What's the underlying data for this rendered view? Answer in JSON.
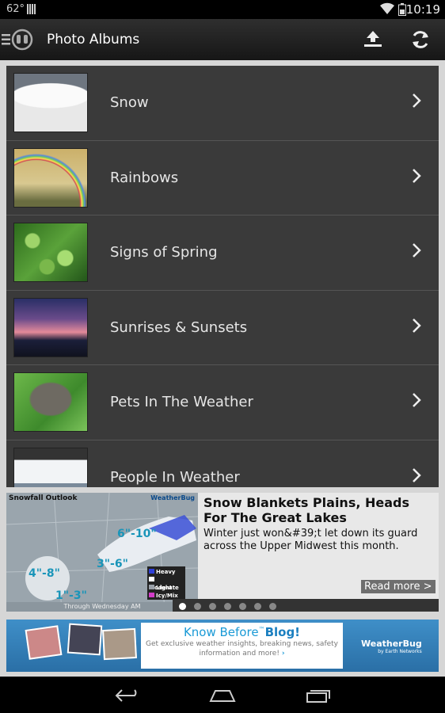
{
  "status_bar": {
    "temperature": "62°",
    "time": "10:19",
    "icons": [
      "notification-icon",
      "wifi-icon",
      "battery-icon"
    ]
  },
  "action_bar": {
    "title": "Photo Albums",
    "icons": [
      "menu-icon",
      "weatherbug-logo-icon",
      "upload-icon",
      "refresh-icon"
    ]
  },
  "albums": [
    {
      "label": "Snow"
    },
    {
      "label": "Rainbows"
    },
    {
      "label": "Signs of Spring"
    },
    {
      "label": "Sunrises & Sunsets"
    },
    {
      "label": "Pets In The Weather"
    },
    {
      "label": "People In Weather"
    }
  ],
  "carousel": {
    "map": {
      "title": "Snowfall Outlook",
      "brand": "WeatherBug",
      "footer": "Through Wednesday AM",
      "amounts": [
        "6\"-10\"",
        "3\"-6\"",
        "4\"-8\"",
        "1\"-3\""
      ],
      "legend": [
        {
          "label": "Heavy",
          "color": "#2f3fd8"
        },
        {
          "label": "Moderate",
          "color": "#ffffff"
        },
        {
          "label": "Light",
          "color": "#9aa0a8"
        },
        {
          "label": "Icy/Mix",
          "color": "#d23cc8"
        }
      ]
    },
    "headline": "Snow Blankets Plains, Heads For The Great Lakes",
    "summary": "Winter just won&#39;t let down its guard across the Upper Midwest this month.",
    "read_more": "Read more >",
    "page_count": 7,
    "active_page": 1
  },
  "ad": {
    "title_prefix": "Know Before",
    "title_tm": "™",
    "title_blog": "Blog!",
    "body": "Get exclusive weather insights, breaking news, safety information and more!",
    "arrow": "›",
    "brand": "WeatherBug",
    "brand_sub": "by Earth Networks"
  },
  "nav_bar": {
    "icons": [
      "back-icon",
      "home-icon",
      "recent-apps-icon"
    ]
  },
  "colors": {
    "list_background": "#3a3a3a",
    "content_background": "#d6d6d6",
    "accent": "#1a9ad6"
  }
}
